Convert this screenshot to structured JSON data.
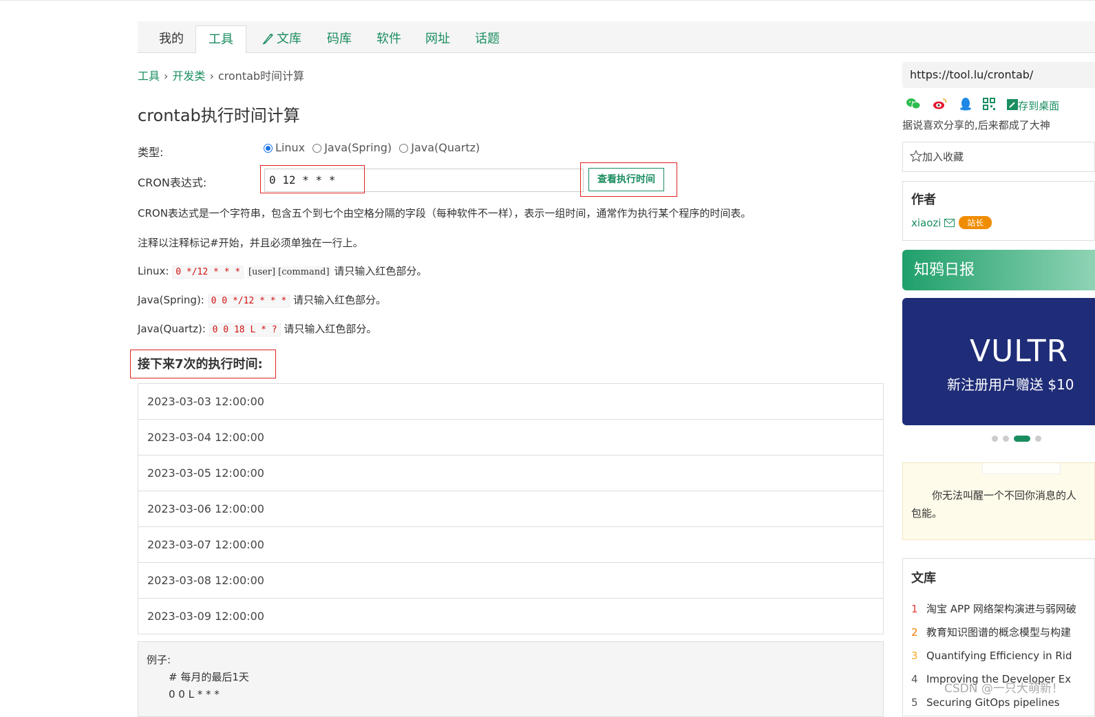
{
  "nav": {
    "tabs": [
      {
        "label": "我的"
      },
      {
        "label": "工具"
      },
      {
        "label": "文库"
      },
      {
        "label": "码库"
      },
      {
        "label": "软件"
      },
      {
        "label": "网址"
      },
      {
        "label": "话题"
      }
    ],
    "active_tab": "工具"
  },
  "breadcrumb": {
    "items": [
      "工具",
      "开发类",
      "crontab时间计算"
    ],
    "separator": "›"
  },
  "page_title": "crontab执行时间计算",
  "form": {
    "type_label": "类型:",
    "types": [
      "Linux",
      "Java(Spring)",
      "Java(Quartz)"
    ],
    "selected_type": "Linux",
    "cron_label": "CRON表达式:",
    "cron_value": "0 12 * * *",
    "submit_label": "查看执行时间"
  },
  "desc": {
    "line1": "CRON表达式是一个字符串，包含五个到七个由空格分隔的字段（每种软件不一样），表示一组时间，通常作为执行某个程序的时间表。",
    "line2": "注释以注释标记#开始，并且必须单独在一行上。",
    "linux_label": "Linux:",
    "linux_code": "0 */12 * * *",
    "linux_rest": "[user] [command]",
    "spring_label": "Java(Spring):",
    "spring_code": "0 0 */12 * * *",
    "quartz_label": "Java(Quartz):",
    "quartz_code": "0 0 18 L * ?",
    "hint": "请只输入红色部分。"
  },
  "results": {
    "title": "接下来7次的执行时间:",
    "times": [
      "2023-03-03 12:00:00",
      "2023-03-04 12:00:00",
      "2023-03-05 12:00:00",
      "2023-03-06 12:00:00",
      "2023-03-07 12:00:00",
      "2023-03-08 12:00:00",
      "2023-03-09 12:00:00"
    ]
  },
  "example": {
    "title": "例子:",
    "comment": "# 每月的最后1天",
    "expr": "0 0 L * * *"
  },
  "sidebar": {
    "url": "https://tool.lu/crontab/",
    "save_desktop": "存到桌面",
    "share_note": "据说喜欢分享的,后来都成了大神",
    "favorite": "加入收藏",
    "author_title": "作者",
    "author_name": "xiaozi",
    "author_badge": "站长",
    "zhiya_title": "知鸦日报",
    "ad_big": "VULTR",
    "ad_small": "新注册用户赠送 $10",
    "note_line1": "你无法叫醒一个不回你消息的人",
    "note_line2": "包能。",
    "lib_title": "文库",
    "lib_items": [
      {
        "rank": "1",
        "text": "淘宝 APP 网络架构演进与弱网破"
      },
      {
        "rank": "2",
        "text": "教育知识图谱的概念模型与构建"
      },
      {
        "rank": "3",
        "text": "Quantifying Efficiency in Rid"
      },
      {
        "rank": "4",
        "text": "Improving the Developer Ex"
      },
      {
        "rank": "5",
        "text": "Securing GitOps pipelines"
      }
    ]
  },
  "watermark": "CSDN @一只大萌新！",
  "colors": {
    "accent": "#1a8d5f",
    "highlight_box": "#e02020",
    "code_red": "#d01010"
  }
}
